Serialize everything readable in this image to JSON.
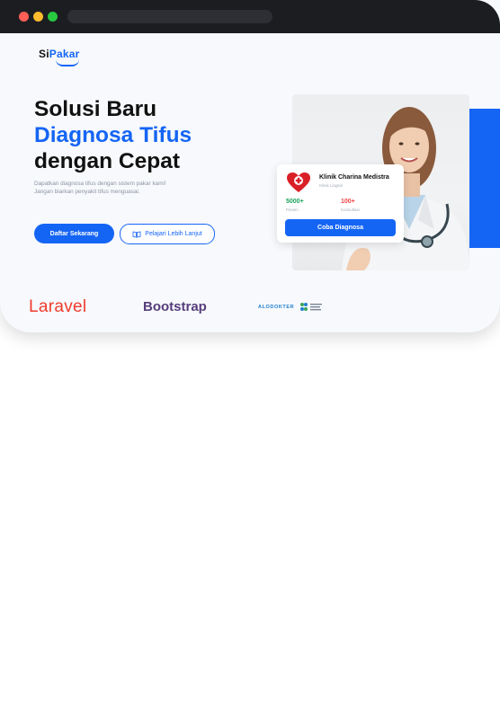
{
  "header": {
    "logo_prefix": "Si",
    "logo_accent": "Pakar"
  },
  "hero": {
    "title_line1": "Solusi Baru",
    "title_line2": "Diagnosa Tifus",
    "title_line3": "dengan Cepat",
    "subtitle_line1": "Dapatkan diagnosa tifus dengan sistem pakar kami!",
    "subtitle_line2": "Jangan biarkan penyakit tifus menguasai.",
    "primary_button": "Daftar Sekarang",
    "secondary_button": "Pelajari Lebih Lanjut"
  },
  "card": {
    "clinic_name": "Klinik Charina Medistra",
    "clinic_location": "Klinik Lingkin",
    "stat1_value": "5000+",
    "stat1_label": "Pasien",
    "stat2_value": "100+",
    "stat2_label": "Konsultasi",
    "button": "Coba Diagnosa"
  },
  "partners": {
    "laravel": "Laravel",
    "bootstrap": "Bootstrap",
    "alodokter": "ALODOKTER"
  },
  "colors": {
    "accent": "#1565f5",
    "laravel": "#ef3b2d",
    "bootstrap": "#563d7c",
    "success": "#19a35b",
    "danger": "#ef4444"
  }
}
